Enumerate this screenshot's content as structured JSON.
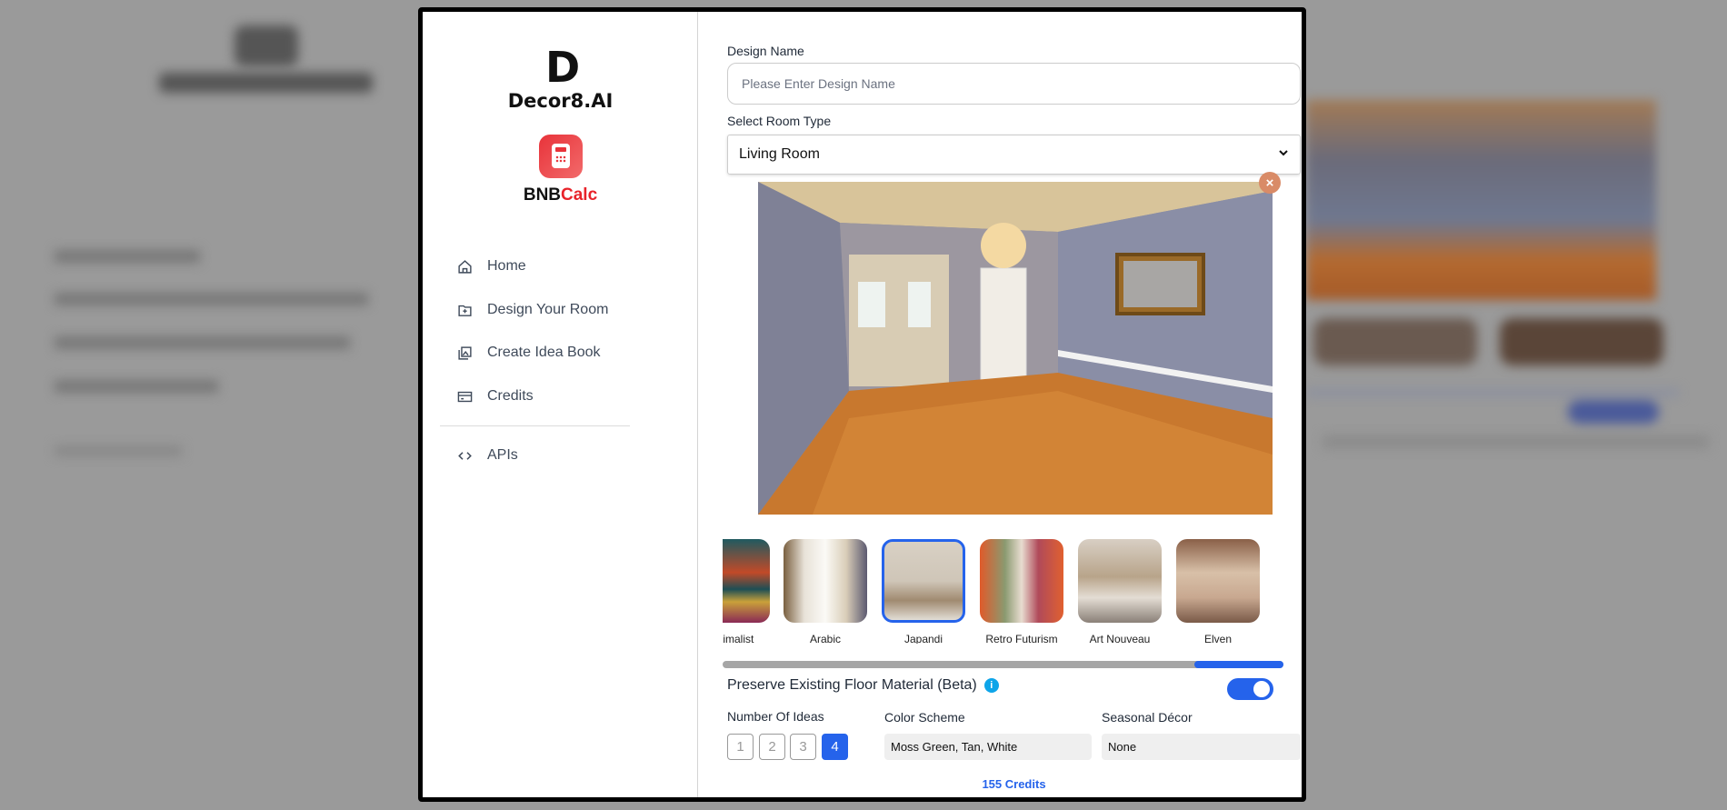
{
  "sidebar": {
    "brand": "Decor8.AI",
    "brand_mark": "D",
    "partner_part1": "BNB",
    "partner_part2": "Calc",
    "items": [
      {
        "label": "Home",
        "icon": "home-icon"
      },
      {
        "label": "Design Your Room",
        "icon": "folder-plus-icon"
      },
      {
        "label": "Create Idea Book",
        "icon": "image-stack-icon"
      },
      {
        "label": "Credits",
        "icon": "credit-card-icon"
      },
      {
        "label": "APIs",
        "icon": "code-icon"
      }
    ]
  },
  "form": {
    "design_name_label": "Design Name",
    "design_name_placeholder": "Please Enter Design Name",
    "design_name_value": "",
    "room_type_label": "Select Room Type",
    "room_type_value": "Living Room",
    "close_glyph": "×",
    "styles": [
      {
        "label": "Maximalist",
        "selected": false
      },
      {
        "label": "Arabic",
        "selected": false
      },
      {
        "label": "Japandi",
        "selected": true
      },
      {
        "label": "Retro Futurism",
        "selected": false
      },
      {
        "label": "Art Nouveau",
        "selected": false
      },
      {
        "label": "Elven",
        "selected": false
      }
    ],
    "preserve_floor_label": "Preserve Existing Floor Material (Beta)",
    "info_glyph": "i",
    "preserve_floor_enabled": true,
    "num_ideas_label": "Number Of Ideas",
    "num_ideas_options": [
      "1",
      "2",
      "3",
      "4"
    ],
    "num_ideas_selected": "4",
    "color_scheme_label": "Color Scheme",
    "color_scheme_value": "Moss Green, Tan, White",
    "seasonal_label": "Seasonal Décor",
    "seasonal_value": "None",
    "credits_text": "155 Credits"
  },
  "colors": {
    "accent": "#2563eb",
    "brand_red": "#e8232a",
    "overlay": "#9a9a9a"
  }
}
